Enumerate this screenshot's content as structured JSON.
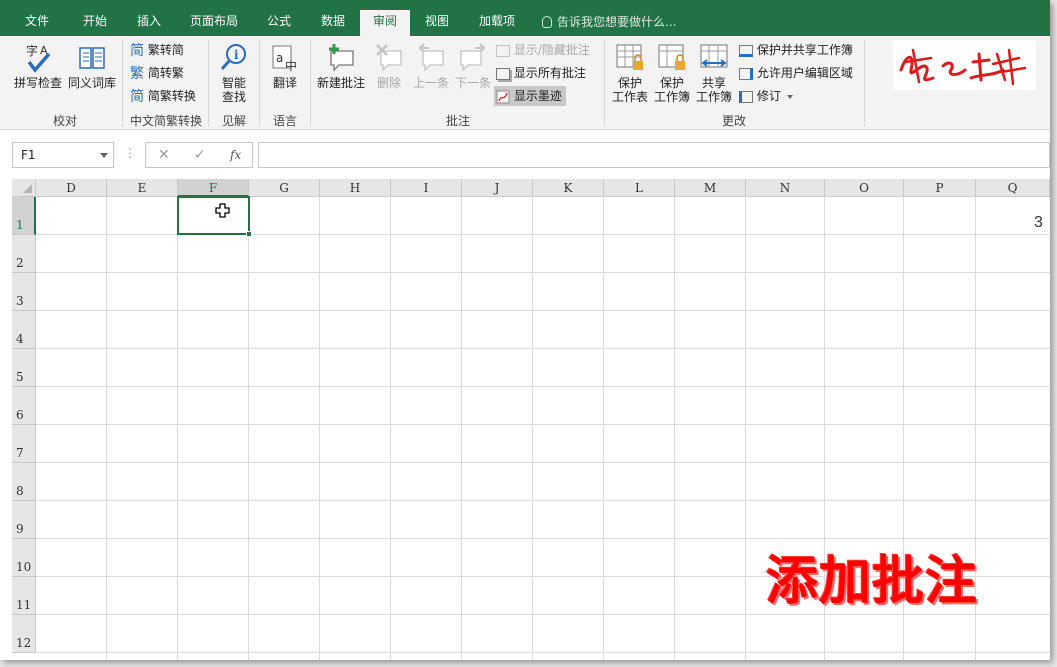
{
  "tabs": [
    {
      "label": "文件"
    },
    {
      "label": "开始"
    },
    {
      "label": "插入"
    },
    {
      "label": "页面布局"
    },
    {
      "label": "公式"
    },
    {
      "label": "数据"
    },
    {
      "label": "审阅",
      "active": true
    },
    {
      "label": "视图"
    },
    {
      "label": "加载项"
    }
  ],
  "tell_me": "告诉我您想要做什么...",
  "ribbon": {
    "proofing": {
      "spell": "拼写检查",
      "thesaurus": "同义词库",
      "group": "校对"
    },
    "chinese": {
      "to_trad": "繁转简",
      "to_simp": "简转繁",
      "convert": "简繁转换",
      "group": "中文简繁转换"
    },
    "insights": {
      "smart_lookup_1": "智能",
      "smart_lookup_2": "查找",
      "group": "见解"
    },
    "language": {
      "translate": "翻译",
      "group": "语言"
    },
    "comments": {
      "new": "新建批注",
      "delete": "删除",
      "prev": "上一条",
      "next": "下一条",
      "show_hide": "显示/隐藏批注",
      "show_all": "显示所有批注",
      "show_ink": "显示墨迹",
      "group": "批注"
    },
    "changes": {
      "protect_sheet_1": "保护",
      "protect_sheet_2": "工作表",
      "protect_wb_1": "保护",
      "protect_wb_2": "工作簿",
      "share_wb_1": "共享",
      "share_wb_2": "工作簿",
      "protect_share": "保护并共享工作簿",
      "allow_edit": "允许用户编辑区域",
      "track": "修订",
      "group": "更改"
    }
  },
  "formula_bar": {
    "name_box": "F1",
    "dots": "⋮",
    "cancel": "✕",
    "enter": "✓",
    "fx": "fx",
    "content": ""
  },
  "grid": {
    "columns": [
      "D",
      "E",
      "F",
      "G",
      "H",
      "I",
      "J",
      "K",
      "L",
      "M",
      "N",
      "O",
      "P",
      "Q"
    ],
    "rows": [
      "1",
      "2",
      "3",
      "4",
      "5",
      "6",
      "7",
      "8",
      "9",
      "10",
      "11",
      "12"
    ],
    "selected_cell": "F1",
    "q1_value": "3"
  },
  "caption": "添加批注",
  "colors": {
    "accent": "#217346",
    "caption": "#ff0000"
  }
}
